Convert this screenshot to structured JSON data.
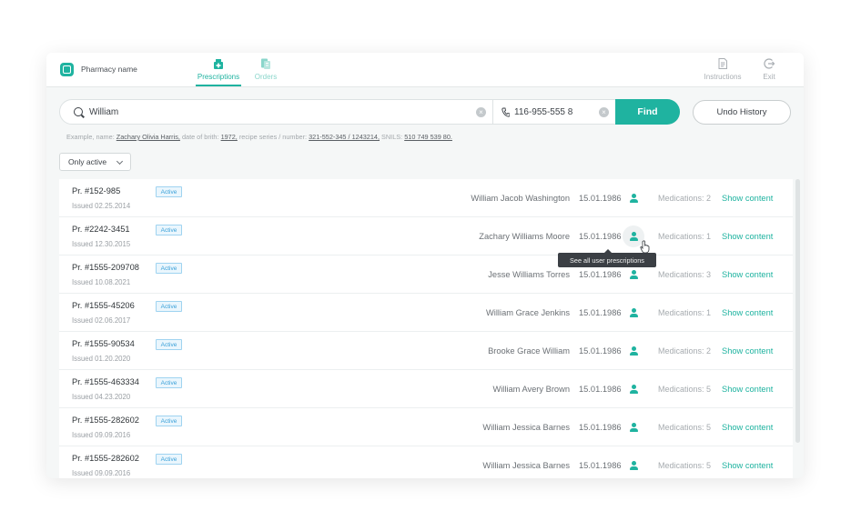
{
  "header": {
    "pharmacy_name": "Pharmacy name",
    "tabs": [
      {
        "label": "Prescriptions",
        "icon": "prescription-icon",
        "active": true
      },
      {
        "label": "Orders",
        "icon": "orders-icon",
        "active": false
      }
    ],
    "instructions_label": "Instructions",
    "exit_label": "Exit"
  },
  "search": {
    "query": "William",
    "phone_value": "116-955-555 8",
    "find_label": "Find",
    "undo_label": "Undo History"
  },
  "example": {
    "prefix": "Example, name:",
    "name": "Zachary Olivia Harris,",
    "dob_label": "date of brith:",
    "dob": "1972,",
    "series_label": "recipe series / number:",
    "series": "321-552-345 / 1243214,",
    "snils_label": "SNILS:",
    "snils": "510 749 539 80."
  },
  "filter": {
    "selected": "Only active"
  },
  "list": {
    "rows": [
      {
        "number": "Pr. #152-985",
        "issued": "Issued 02.25.2014",
        "status": "Active",
        "patient": "William Jacob Washington",
        "date": "15.01.1986",
        "medications": "Medications: 2",
        "action": "Show content"
      },
      {
        "number": "Pr. #2242-3451",
        "issued": "Issued 12.30.2015",
        "status": "Active",
        "patient": "Zachary Williams Moore",
        "date": "15.01.1986",
        "medications": "Medications: 1",
        "action": "Show content"
      },
      {
        "number": "Pr. #1555-209708",
        "issued": "Issued 10.08.2021",
        "status": "Active",
        "patient": "Jesse Williams Torres",
        "date": "15.01.1986",
        "medications": "Medications: 3",
        "action": "Show content"
      },
      {
        "number": "Pr. #1555-45206",
        "issued": "Issued 02.06.2017",
        "status": "Active",
        "patient": "William Grace Jenkins",
        "date": "15.01.1986",
        "medications": "Medications: 1",
        "action": "Show content"
      },
      {
        "number": "Pr. #1555-90534",
        "issued": "Issued 01.20.2020",
        "status": "Active",
        "patient": "Brooke Grace William",
        "date": "15.01.1986",
        "medications": "Medications: 2",
        "action": "Show content"
      },
      {
        "number": "Pr. #1555-463334",
        "issued": "Issued 04.23.2020",
        "status": "Active",
        "patient": "William Avery Brown",
        "date": "15.01.1986",
        "medications": "Medications: 5",
        "action": "Show content"
      },
      {
        "number": "Pr. #1555-282602",
        "issued": "Issued 09.09.2016",
        "status": "Active",
        "patient": "William Jessica Barnes",
        "date": "15.01.1986",
        "medications": "Medications: 5",
        "action": "Show content"
      },
      {
        "number": "Pr. #1555-282602",
        "issued": "Issued 09.09.2016",
        "status": "Active",
        "patient": "William Jessica Barnes",
        "date": "15.01.1986",
        "medications": "Medications: 5",
        "action": "Show content"
      }
    ]
  },
  "tooltip": {
    "text": "See all user prescriptions"
  },
  "colors": {
    "accent": "#1fb3a0",
    "badge": "#3aa0d8"
  }
}
